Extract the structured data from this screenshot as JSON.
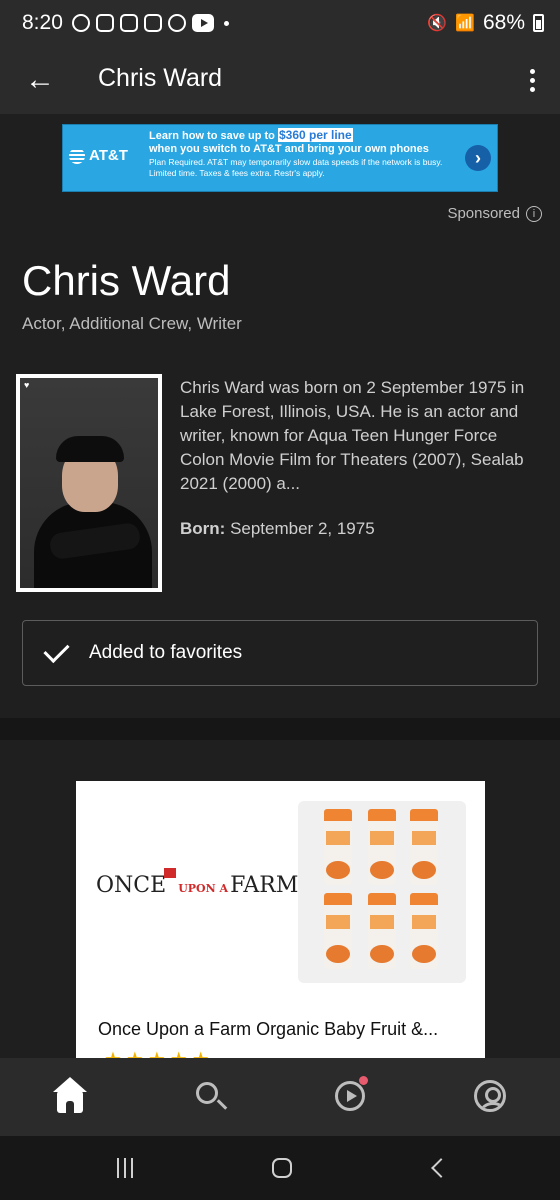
{
  "status_bar": {
    "time": "8:20",
    "battery": "68%",
    "notification_icons": [
      "messenger-icon",
      "instagram-icon",
      "instagram-icon",
      "instagram-icon",
      "pinterest-icon",
      "youtube-icon"
    ]
  },
  "app_bar": {
    "title": "Chris Ward"
  },
  "top_ad": {
    "brand": "AT&T",
    "line1_pre": "Learn how to save up to",
    "line1_highlight": "$360 per line",
    "line2": "when you switch to AT&T and bring your own phones",
    "line3": "Plan Required. AT&T may temporarily slow data speeds if the network is busy. Limited time. Taxes & fees extra. Restr's apply.",
    "sponsored_label": "Sponsored"
  },
  "person": {
    "name": "Chris Ward",
    "roles": "Actor, Additional Crew, Writer",
    "bio": "Chris Ward was born on 2 September 1975 in Lake Forest, Illinois, USA. He is an actor and writer, known for Aqua Teen Hunger Force Colon Movie Film for Theaters (2007), Sealab 2021 (2000) a...",
    "born_label": "Born:",
    "born_value": "September 2, 1975"
  },
  "favorites_button": {
    "label": "Added to favorites"
  },
  "product_ad": {
    "brand_left": "ONCE",
    "brand_mid": "UPON A",
    "brand_right": "FARM",
    "title": "Once Upon a Farm Organic Baby Fruit &...",
    "rating_stars": 5
  },
  "bottom_nav": {
    "items": [
      "home-icon",
      "search-icon",
      "play-icon",
      "account-icon"
    ]
  }
}
